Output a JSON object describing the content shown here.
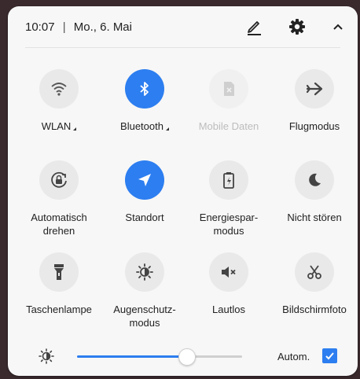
{
  "header": {
    "time": "10:07",
    "separator": "|",
    "date": "Mo., 6. Mai"
  },
  "tiles": [
    {
      "label": "WLAN",
      "icon": "wifi-icon",
      "active": false,
      "dropdown": true
    },
    {
      "label": "Bluetooth",
      "icon": "bluetooth-icon",
      "active": true,
      "dropdown": true
    },
    {
      "label": "Mobile Daten",
      "icon": "mobile-data-icon",
      "active": false,
      "disabled": true
    },
    {
      "label": "Flugmodus",
      "icon": "airplane-icon",
      "active": false
    },
    {
      "label": "Automatisch\ndrehen",
      "icon": "auto-rotate-icon",
      "active": false
    },
    {
      "label": "Standort",
      "icon": "location-icon",
      "active": true
    },
    {
      "label": "Energiespar-\nmodus",
      "icon": "battery-saver-icon",
      "active": false
    },
    {
      "label": "Nicht stören",
      "icon": "moon-icon",
      "active": false
    },
    {
      "label": "Taschenlampe",
      "icon": "flashlight-icon",
      "active": false
    },
    {
      "label": "Augenschutz-\nmodus",
      "icon": "eye-comfort-icon",
      "active": false
    },
    {
      "label": "Lautlos",
      "icon": "mute-icon",
      "active": false
    },
    {
      "label": "Bildschirmfoto",
      "icon": "screenshot-icon",
      "active": false
    }
  ],
  "brightness": {
    "level": 0.66,
    "auto_label": "Autom.",
    "auto_checked": true
  },
  "colors": {
    "accent": "#2d7ef0",
    "tile_bg": "#e9e9e9",
    "panel_bg": "#f7f7f7"
  }
}
